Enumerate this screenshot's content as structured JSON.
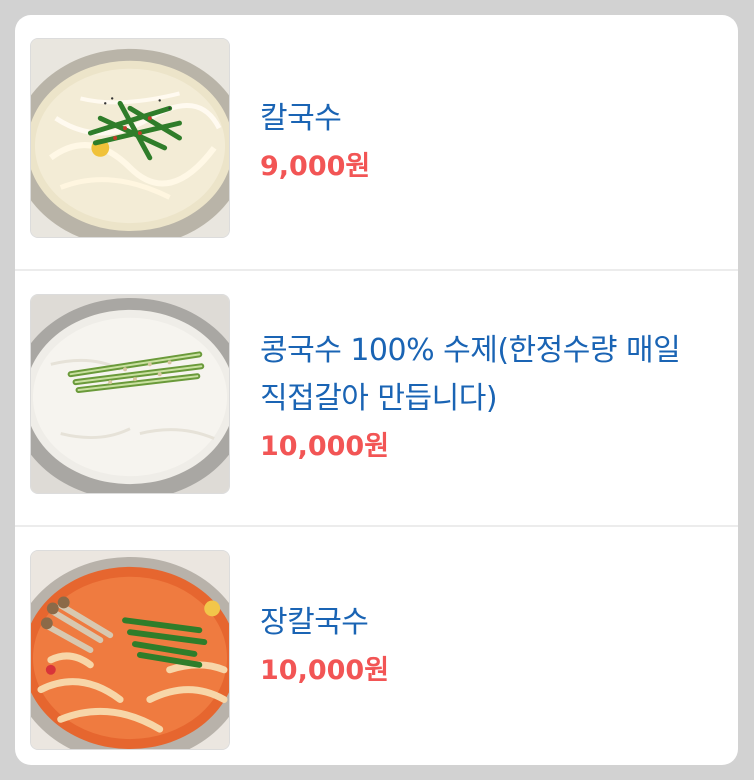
{
  "menu": {
    "items": [
      {
        "name": "칼국수",
        "price": "9,000원",
        "image": "kalguksu-photo"
      },
      {
        "name": "콩국수 100% 수제(한정수량 매일 직접갈아 만듭니다)",
        "price": "10,000원",
        "image": "kongguksu-photo"
      },
      {
        "name": "장칼국수",
        "price": "10,000원",
        "image": "jangkalguksu-photo"
      }
    ]
  },
  "colors": {
    "name_text": "#1a64b4",
    "price_text": "#f25555",
    "card_background": "#ffffff",
    "page_background": "#d2d2d2"
  }
}
